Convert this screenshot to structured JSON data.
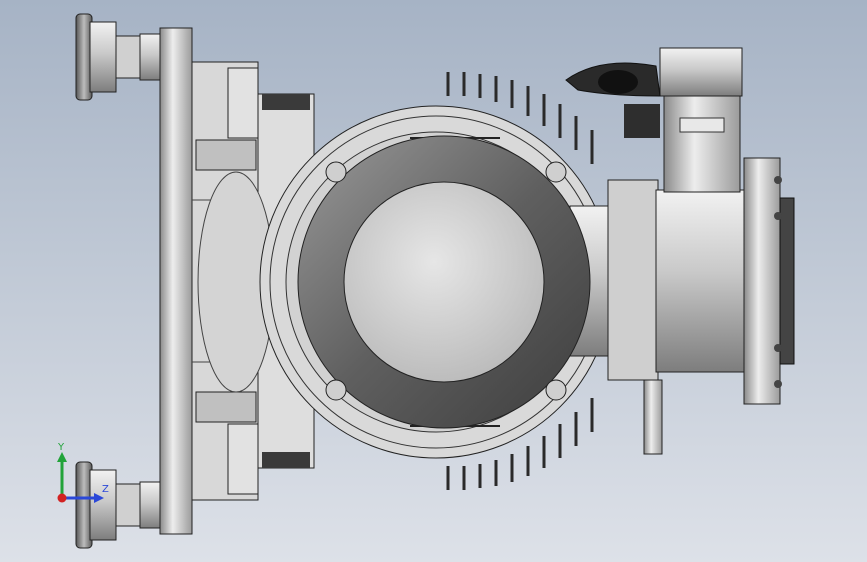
{
  "viewport": {
    "triad": {
      "y_label": "Y",
      "z_label": "Z",
      "colors": {
        "y": "#22a33a",
        "z": "#2b48d8",
        "x": "#d22222"
      }
    },
    "background": {
      "top": "#a6b3c5",
      "bottom": "#dde1e8"
    }
  }
}
